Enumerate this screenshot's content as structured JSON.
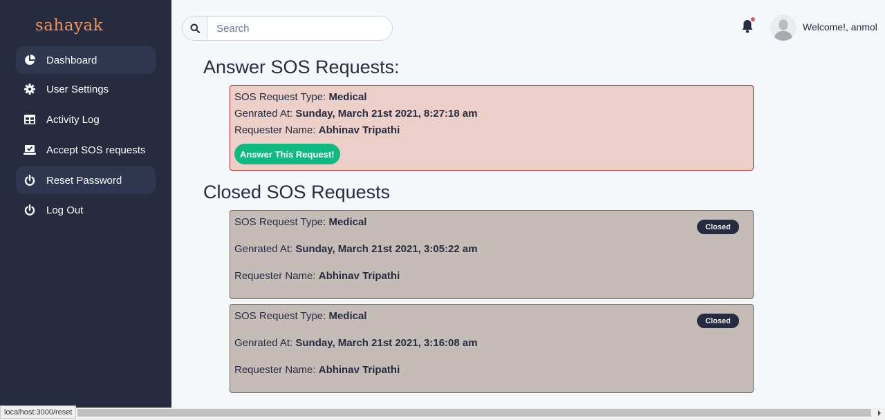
{
  "brand": "sahayak",
  "nav": [
    {
      "label": "Dashboard",
      "icon": "chart-pie-icon",
      "active": true
    },
    {
      "label": "User Settings",
      "icon": "gear-icon",
      "active": false
    },
    {
      "label": "Activity Log",
      "icon": "table-icon",
      "active": false
    },
    {
      "label": "Accept SOS requests",
      "icon": "laptop-check-icon",
      "active": false
    },
    {
      "label": "Reset Password",
      "icon": "power-icon",
      "active": true
    },
    {
      "label": "Log Out",
      "icon": "power-icon",
      "active": false
    }
  ],
  "search": {
    "placeholder": "Search"
  },
  "header": {
    "welcome": "Welcome!, anmol"
  },
  "answer_section": {
    "title": "Answer SOS Requests:",
    "request": {
      "type_label": "SOS Request Type: ",
      "type_value": "Medical",
      "generated_label": "Genrated At: ",
      "generated_value": "Sunday, March 21st 2021, 8:27:18 am",
      "requester_label": "Requester Name: ",
      "requester_value": "Abhinav Tripathi",
      "button": "Answer This Request!"
    }
  },
  "closed_section": {
    "title": "Closed SOS Requests",
    "requests": [
      {
        "type_label": "SOS Request Type: ",
        "type_value": "Medical",
        "generated_label": "Genrated At: ",
        "generated_value": "Sunday, March 21st 2021, 3:05:22 am",
        "requester_label": "Requester Name: ",
        "requester_value": "Abhinav Tripathi",
        "badge": "Closed"
      },
      {
        "type_label": "SOS Request Type: ",
        "type_value": "Medical",
        "generated_label": "Genrated At: ",
        "generated_value": "Sunday, March 21st 2021, 3:16:08 am",
        "requester_label": "Requester Name: ",
        "requester_value": "Abhinav Tripathi",
        "badge": "Closed"
      }
    ]
  },
  "statusbar": "localhost:3000/reset",
  "colors": {
    "sidebar": "#262b40",
    "brand": "#f0965a",
    "answer_button": "#10b981",
    "open_card_bg": "#eccfc8",
    "closed_card_bg": "#c6bcb7"
  }
}
